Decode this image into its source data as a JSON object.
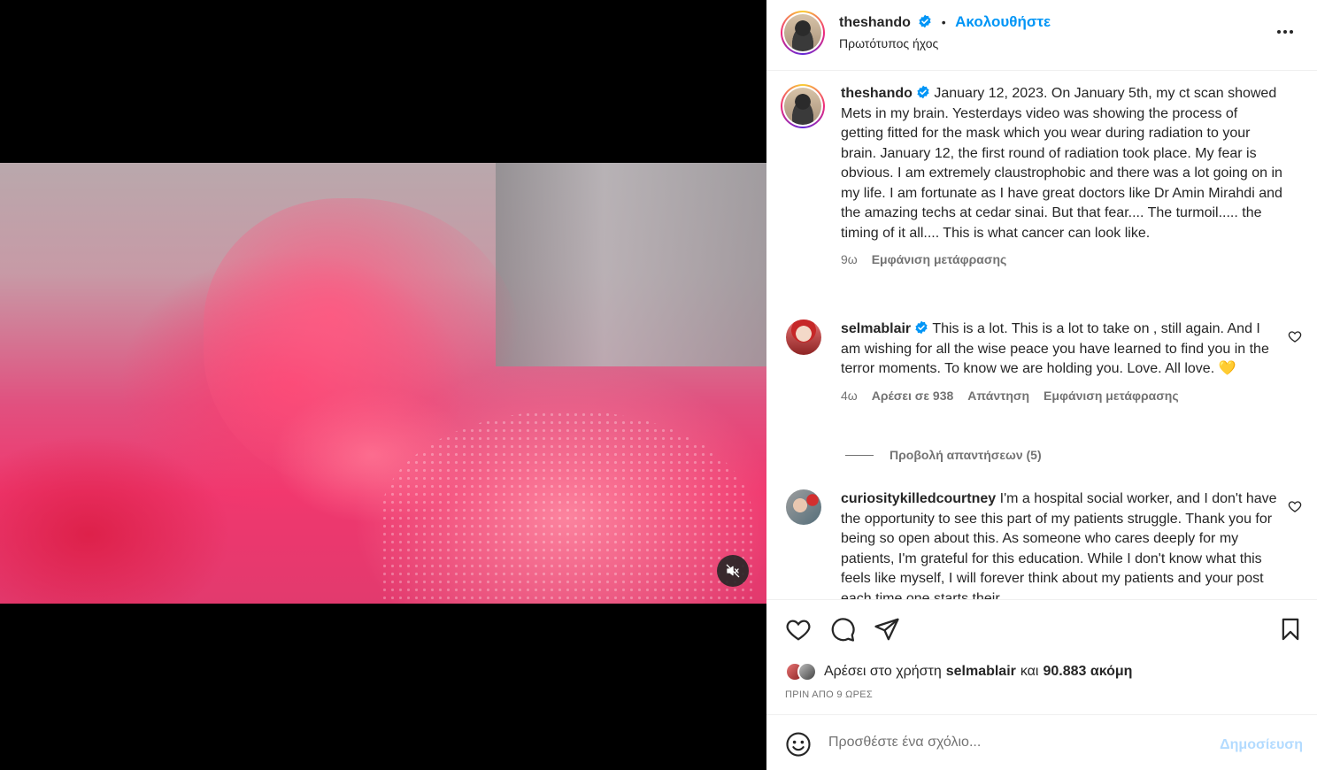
{
  "post": {
    "author": "theshando",
    "follow_label": "Ακολουθήστε",
    "separator": "•",
    "audio": "Πρωτότυπος ήχος",
    "more_icon": "more-horizontal-icon"
  },
  "media": {
    "mute_icon": "speaker-muted-icon"
  },
  "caption": {
    "username": "theshando",
    "text": "January 12, 2023. On January 5th, my ct scan showed Mets in my brain. Yesterdays video was showing the process of getting fitted for the mask which you wear during radiation to your brain. January 12, the first round of radiation took place. My fear is obvious. I am extremely claustrophobic and there was a lot going on in my life. I am fortunate as I have great doctors like Dr Amin Mirahdi and the amazing techs at cedar sinai. But that fear.... The turmoil..... the timing of it all.... This is what cancer can look like.",
    "time": "9ω",
    "translate": "Εμφάνιση μετάφρασης"
  },
  "comments": [
    {
      "username": "selmablair",
      "text": "This is a lot. This is a lot to take on , still again. And I am wishing for all the wise peace you have learned to find you in the terror moments. To know we are holding you. Love. All love. 💛",
      "time": "4ω",
      "likes": "Αρέσει σε 938",
      "reply": "Απάντηση",
      "translate": "Εμφάνιση μετάφρασης",
      "view_replies": "Προβολή απαντήσεων (5)"
    },
    {
      "username": "curiositykilledcourtney",
      "text": "I'm a hospital social worker, and I don't have the opportunity to see this part of my patients struggle. Thank you for being so open about this. As someone who cares deeply for my patients, I'm grateful for this education. While I don't know what this feels like myself, I will forever think about my patients and your post each time one starts their"
    }
  ],
  "likes_line": {
    "prefix": "Αρέσει στο χρήστη",
    "user": "selmablair",
    "middle": "και",
    "count": "90.883 ακόμη"
  },
  "timestamp": "ΠΡΙΝ ΑΠΟ 9 ΩΡΕΣ",
  "composer": {
    "placeholder": "Προσθέστε ένα σχόλιο...",
    "post_label": "Δημοσίευση"
  },
  "colors": {
    "accent": "#0095f6",
    "verified": "#0095f6",
    "post_disabled": "#b3dbff"
  }
}
